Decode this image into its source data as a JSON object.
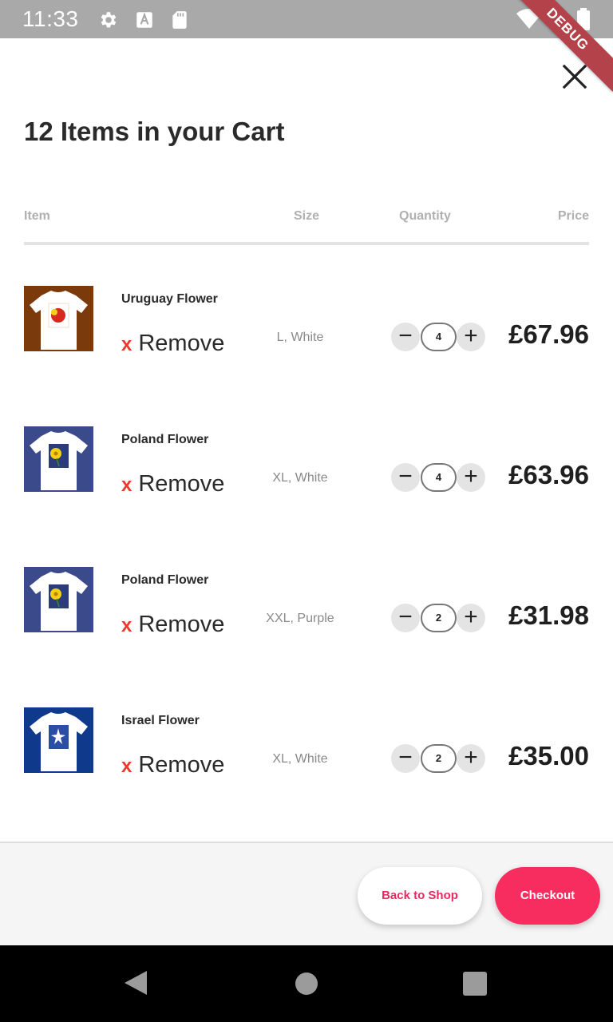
{
  "status_bar": {
    "time": "11:33",
    "icons": [
      "gear-icon",
      "a-icon",
      "sd-card-icon",
      "wifi-icon",
      "signal-icon",
      "battery-icon"
    ]
  },
  "debug_banner": "DEBUG",
  "title": "12 Items in your Cart",
  "headers": {
    "item": "Item",
    "size": "Size",
    "quantity": "Quantity",
    "price": "Price"
  },
  "remove_x": "x",
  "remove_label": "Remove",
  "qty_minus": "−",
  "qty_plus": "+",
  "items": [
    {
      "name": "Uruguay Flower",
      "size": "L, White",
      "quantity": "4",
      "price": "£67.96",
      "poster_bg": "#7a3a0c",
      "poster_art": "#d62a1e"
    },
    {
      "name": "Poland Flower",
      "size": "XL, White",
      "quantity": "4",
      "price": "£63.96",
      "poster_bg": "#3a4a8a",
      "poster_art": "#f2d20e"
    },
    {
      "name": "Poland Flower",
      "size": "XXL, Purple",
      "quantity": "2",
      "price": "£31.98",
      "poster_bg": "#3a4a8a",
      "poster_art": "#f2d20e"
    },
    {
      "name": "Israel Flower",
      "size": "XL, White",
      "quantity": "2",
      "price": "£35.00",
      "poster_bg": "#0f3a8c",
      "poster_art": "#2a4ea8"
    }
  ],
  "footer": {
    "back_label": "Back to Shop",
    "checkout_label": "Checkout"
  },
  "colors": {
    "accent": "#f72d5f",
    "remove_x": "#e53a2e",
    "status_bar": "#a9a9a9"
  }
}
